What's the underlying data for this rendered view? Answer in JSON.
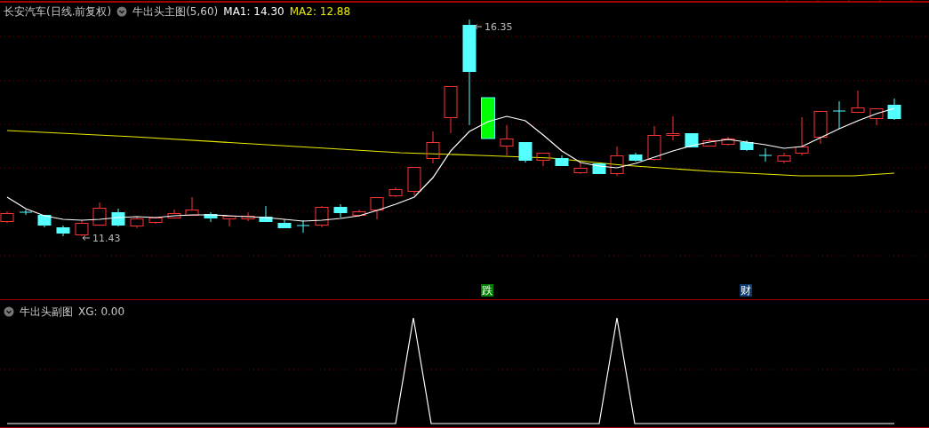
{
  "main_chart": {
    "stock": "长安汽车(日线.前复权)",
    "indicator": "牛出头主图(5,60)",
    "ma1": "MA1: 14.30",
    "ma2": "MA2: 12.88",
    "high_label": "16.35",
    "low_label": "11.43",
    "signals": [
      {
        "text": "跌",
        "color": "#008000"
      },
      {
        "text": "财",
        "color": "#0a3a6e"
      }
    ]
  },
  "sub_chart": {
    "indicator": "牛出头副图",
    "xg": "XG: 0.00"
  }
}
